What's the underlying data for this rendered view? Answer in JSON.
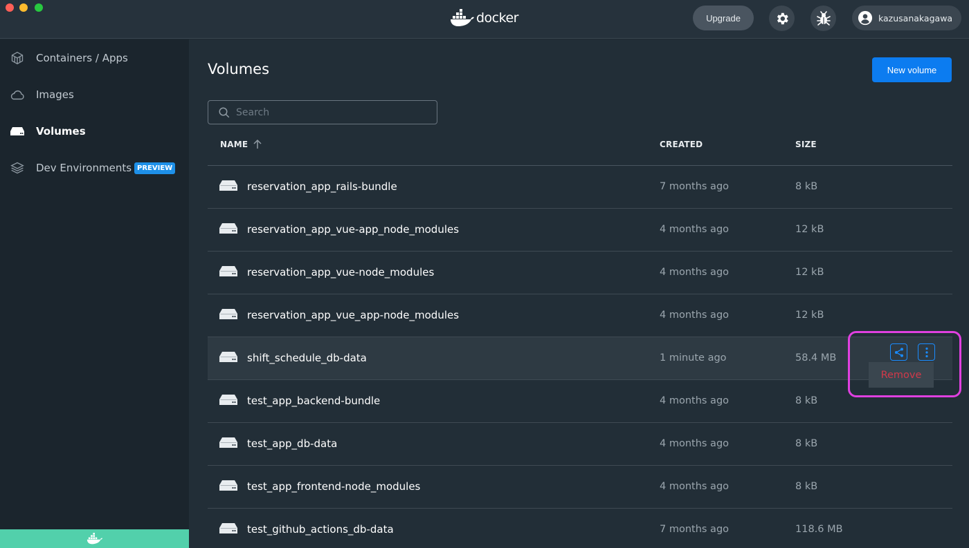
{
  "app": {
    "logo_text": "docker",
    "upgrade_label": "Upgrade",
    "username": "kazusanakagawa"
  },
  "sidebar": {
    "items": [
      {
        "label": "Containers / Apps",
        "icon": "cube-icon",
        "active": false
      },
      {
        "label": "Images",
        "icon": "cloud-icon",
        "active": false
      },
      {
        "label": "Volumes",
        "icon": "drive-icon",
        "active": true
      },
      {
        "label": "Dev Environments",
        "icon": "layers-icon",
        "active": false,
        "badge": "PREVIEW"
      }
    ]
  },
  "page": {
    "title": "Volumes",
    "new_button": "New volume",
    "search_placeholder": "Search"
  },
  "table": {
    "columns": {
      "name": "NAME",
      "created": "CREATED",
      "size": "SIZE"
    },
    "rows": [
      {
        "name": "reservation_app_rails-bundle",
        "created": "7 months ago",
        "size": "8 kB"
      },
      {
        "name": "reservation_app_vue-app_node_modules",
        "created": "4 months ago",
        "size": "12 kB"
      },
      {
        "name": "reservation_app_vue-node_modules",
        "created": "4 months ago",
        "size": "12 kB"
      },
      {
        "name": "reservation_app_vue_app-node_modules",
        "created": "4 months ago",
        "size": "12 kB"
      },
      {
        "name": "shift_schedule_db-data",
        "created": "1 minute ago",
        "size": "58.4 MB"
      },
      {
        "name": "test_app_backend-bundle",
        "created": "4 months ago",
        "size": "8 kB"
      },
      {
        "name": "test_app_db-data",
        "created": "4 months ago",
        "size": "8 kB"
      },
      {
        "name": "test_app_frontend-node_modules",
        "created": "4 months ago",
        "size": "8 kB"
      },
      {
        "name": "test_github_actions_db-data",
        "created": "7 months ago",
        "size": "118.6 MB"
      }
    ]
  },
  "context_menu": {
    "remove_label": "Remove"
  },
  "colors": {
    "accent": "#0c7cf0",
    "remove": "#d1394a",
    "annotation": "#e040e0",
    "whale_bar": "#52d0ab"
  }
}
